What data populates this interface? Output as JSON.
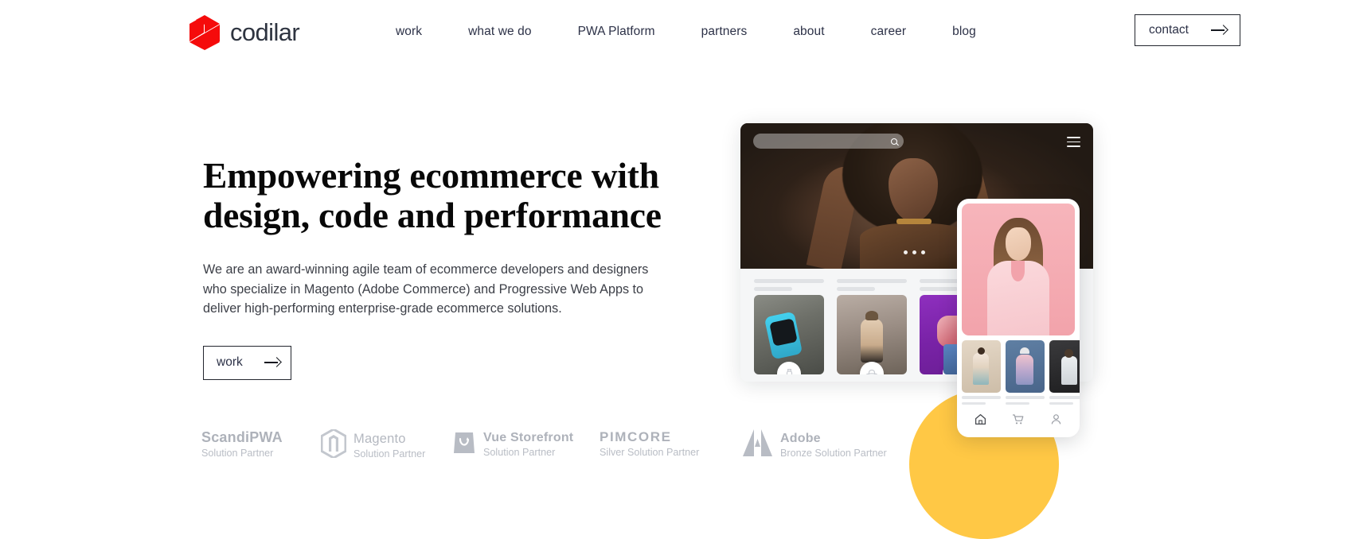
{
  "brand": {
    "name": "codilar",
    "logo_icon": "codilar-cube-logo",
    "logo_color": "#f50b0b"
  },
  "nav": {
    "items": [
      {
        "label": "work"
      },
      {
        "label": "what we do"
      },
      {
        "label": "PWA Platform"
      },
      {
        "label": "partners"
      },
      {
        "label": "about"
      },
      {
        "label": "career"
      },
      {
        "label": "blog"
      }
    ],
    "contact": {
      "label": "contact",
      "icon": "arrow-right-icon"
    }
  },
  "hero": {
    "headline": "Empowering ecommerce with design, code and performance",
    "subcopy": "We are an award-winning agile team of ecommerce developers and designers who specialize in Magento (Adobe Commerce) and Progressive Web Apps to deliver high-performing enterprise-grade ecommerce solutions.",
    "cta": {
      "label": "work",
      "icon": "arrow-right-icon"
    }
  },
  "partners": [
    {
      "name": "ScandiPWA",
      "tier": "Solution Partner",
      "icon": "none",
      "style": "bold"
    },
    {
      "name": "Magento",
      "tier": "Solution Partner",
      "icon": "magento-icon",
      "style": "light"
    },
    {
      "name": "Vue Storefront",
      "tier": "Solution Partner",
      "icon": "vue-storefront-icon",
      "style": "bold"
    },
    {
      "name": "PIMCORE",
      "tier": "Silver Solution Partner",
      "icon": "none",
      "style": "bold"
    },
    {
      "name": "Adobe",
      "tier": "Bronze Solution Partner",
      "icon": "adobe-icon",
      "style": "bold"
    }
  ],
  "mockup": {
    "desktop": {
      "search_placeholder": "",
      "search_icon": "search-icon",
      "menu_icon": "hamburger-menu-icon",
      "carousel_dots": 3,
      "products": [
        {
          "badge_icon": "watch-icon"
        },
        {
          "badge_icon": "hat-icon"
        },
        {
          "badge_icon": "tshirt-icon"
        }
      ]
    },
    "phone": {
      "nav_items": [
        {
          "icon": "home-icon"
        },
        {
          "icon": "cart-icon"
        },
        {
          "icon": "user-icon"
        }
      ],
      "thumbnails": 3
    },
    "decoration": {
      "shape": "circle",
      "color": "#ffc845"
    }
  }
}
